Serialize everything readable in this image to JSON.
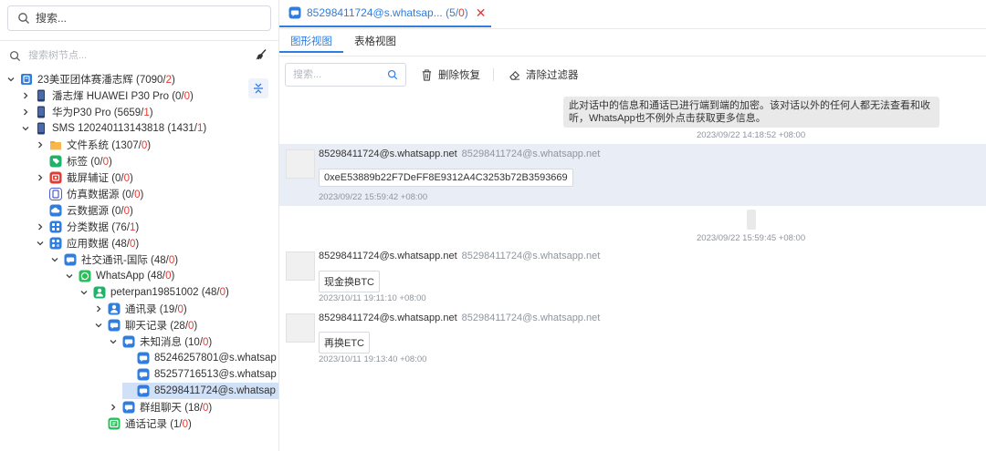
{
  "left": {
    "search_placeholder": "搜索...",
    "tree_search_placeholder": "搜索树节点..."
  },
  "tree": [
    {
      "label": "23美亚团体赛潘志辉 (7090/",
      "count": "2",
      "tail": ")",
      "icon": "case-icon"
    },
    {
      "label": "潘志煇 HUAWEI P30 Pro (0/",
      "count": "0",
      "tail": ")",
      "icon": "phone-icon"
    },
    {
      "label": "华为P30 Pro (5659/",
      "count": "1",
      "tail": ")",
      "icon": "phone-icon"
    },
    {
      "label": "SMS 120240113143818 (1431/",
      "count": "1",
      "tail": ")",
      "icon": "phone-icon"
    },
    {
      "label": "文件系统 (1307/",
      "count": "0",
      "tail": ")",
      "icon": "folder-icon"
    },
    {
      "label": "标签 (0/",
      "count": "0",
      "tail": ")",
      "icon": "tag-icon"
    },
    {
      "label": "截屏辅证 (0/",
      "count": "0",
      "tail": ")",
      "icon": "screenshot-icon"
    },
    {
      "label": "仿真数据源 (0/",
      "count": "0",
      "tail": ")",
      "icon": "emulator-icon"
    },
    {
      "label": "云数据源 (0/",
      "count": "0",
      "tail": ")",
      "icon": "cloud-icon"
    },
    {
      "label": "分类数据 (76/",
      "count": "1",
      "tail": ")",
      "icon": "category-icon"
    },
    {
      "label": "应用数据 (48/",
      "count": "0",
      "tail": ")",
      "icon": "apps-icon"
    },
    {
      "label": "社交通讯-国际 (48/",
      "count": "0",
      "tail": ")",
      "icon": "chat-icon"
    },
    {
      "label": "WhatsApp (48/",
      "count": "0",
      "tail": ")",
      "icon": "whatsapp-icon"
    },
    {
      "label": "peterpan19851002 (48/",
      "count": "0",
      "tail": ")",
      "icon": "account-icon"
    },
    {
      "label": "通讯录 (19/",
      "count": "0",
      "tail": ")",
      "icon": "contacts-icon"
    },
    {
      "label": "聊天记录 (28/",
      "count": "0",
      "tail": ")",
      "icon": "chat-icon"
    },
    {
      "label": "未知消息 (10/",
      "count": "0",
      "tail": ")",
      "icon": "chat-icon"
    },
    {
      "label": "85246257801@s.whatsap",
      "count": "",
      "tail": "",
      "icon": "chat-icon"
    },
    {
      "label": "85257716513@s.whatsap",
      "count": "",
      "tail": "",
      "icon": "chat-icon"
    },
    {
      "label": "85298411724@s.whatsap",
      "count": "",
      "tail": "",
      "icon": "chat-icon"
    },
    {
      "label": "群组聊天 (18/",
      "count": "0",
      "tail": ")",
      "icon": "chat-icon"
    },
    {
      "label": "通话记录 (1/",
      "count": "0",
      "tail": ")",
      "icon": "call-log-icon"
    }
  ],
  "tab": {
    "title": "85298411724@s.whatsap...",
    "count_prefix": "(5/",
    "count_red": "0",
    "count_suffix": ")"
  },
  "views": [
    "图形视图",
    "表格视图"
  ],
  "toolbar": {
    "search_placeholder": "搜索...",
    "restore_label": "删除恢复",
    "clear_filter_label": "清除过滤器"
  },
  "messages": {
    "system_text": "此对话中的信息和通话已进行端到端的加密。该对话以外的任何人都无法查看和收听，WhatsApp也不例外点击获取更多信息。",
    "system_time": "2023/09/22 14:18:52 +08:00",
    "m1": {
      "sender": "85298411724@s.whatsapp.net",
      "sub": "85298411724@s.whatsapp.net",
      "text": "0xeE53889b22F7DeFF8E9312A4C3253b72B3593669",
      "time": "2023/09/22 15:59:42 +08:00"
    },
    "empty_time": "2023/09/22 15:59:45 +08:00",
    "m2": {
      "sender": "85298411724@s.whatsapp.net",
      "sub": "85298411724@s.whatsapp.net",
      "text": "现金换BTC",
      "time": "2023/10/11 19:11:10 +08:00"
    },
    "m3": {
      "sender": "85298411724@s.whatsapp.net",
      "sub": "85298411724@s.whatsapp.net",
      "text": "再换ETC",
      "time": "2023/10/11 19:13:40 +08:00"
    }
  },
  "colors": {
    "accent": "#2f7de1",
    "alert": "#e53935",
    "selected_row": "#cfe0f7",
    "whatsapp": "#25c05a"
  }
}
